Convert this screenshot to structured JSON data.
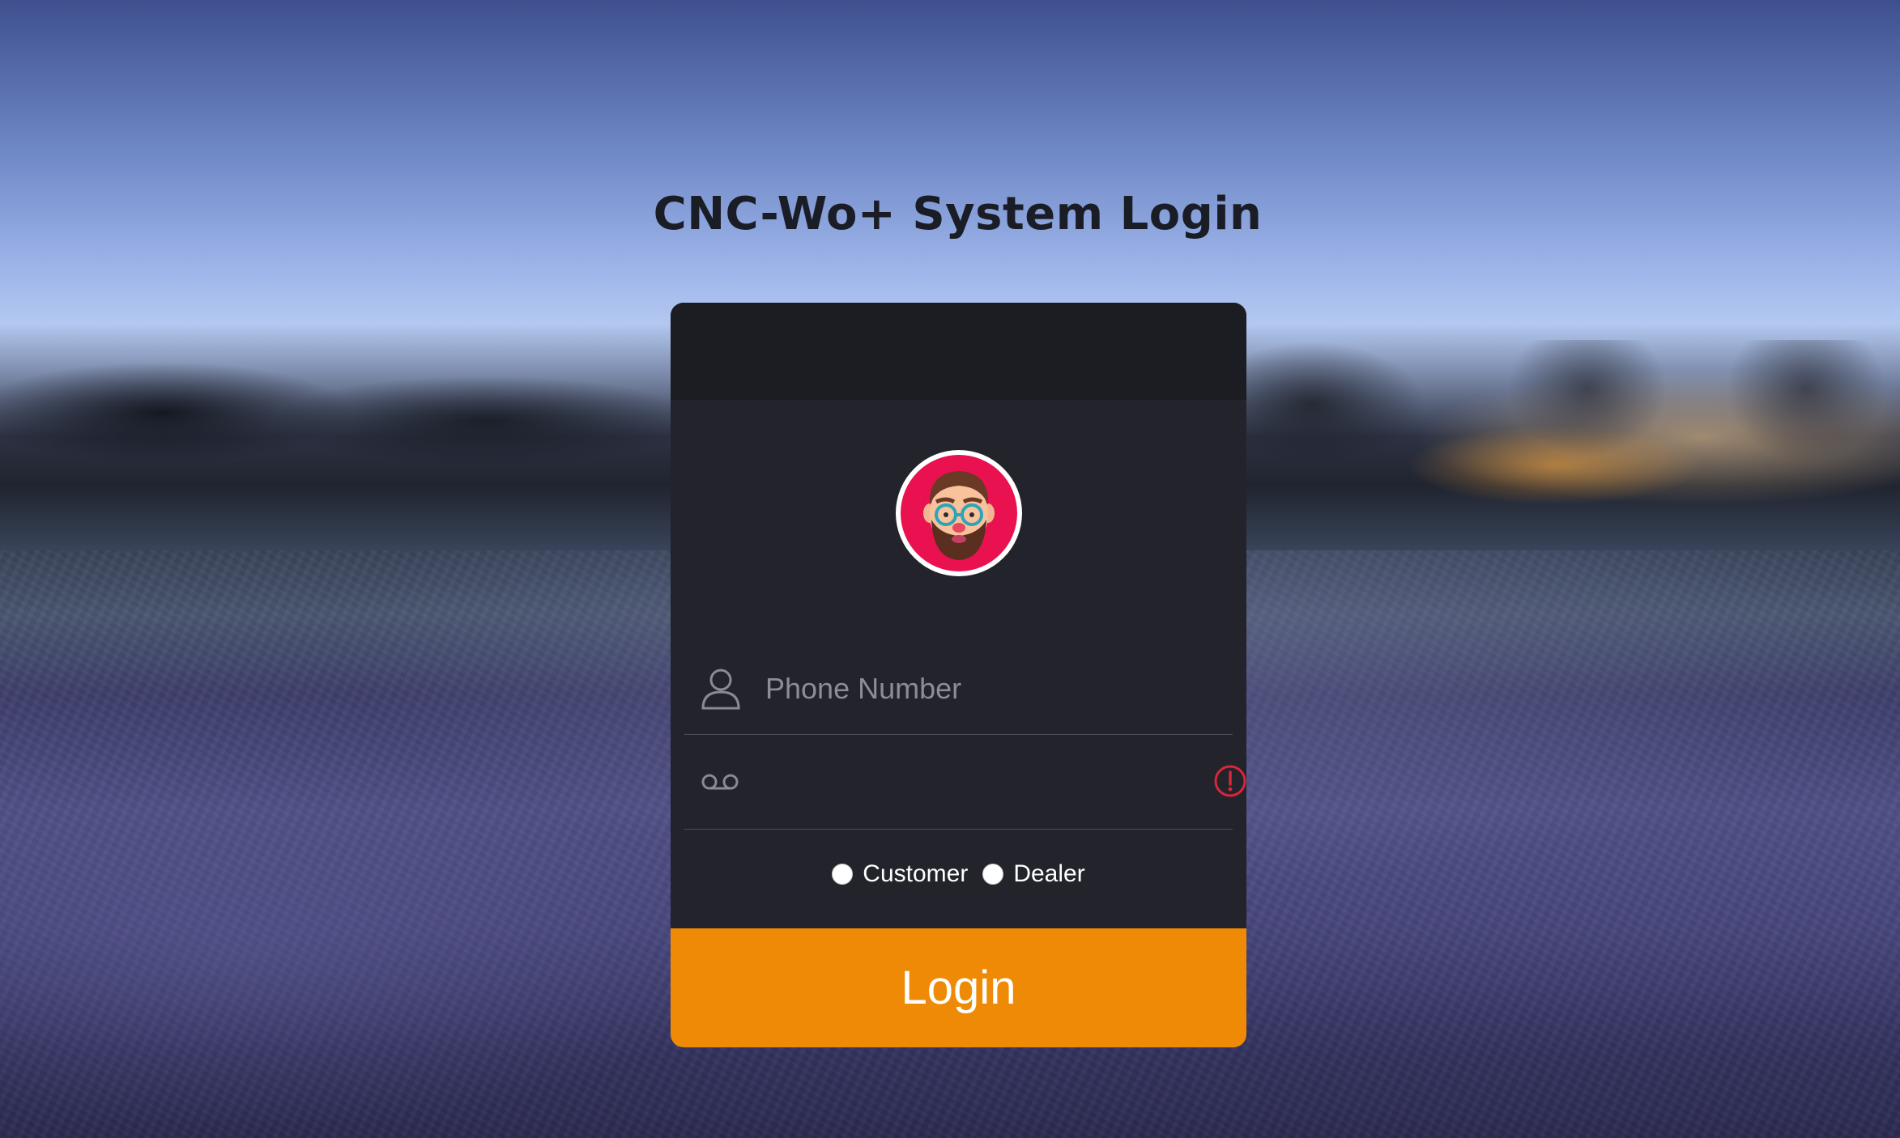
{
  "page": {
    "title": "CNC-Wo+ System Login"
  },
  "login_card": {
    "avatar_icon": "bearded-man-with-glasses-avatar",
    "phone_field": {
      "icon": "user-icon",
      "placeholder": "Phone Number",
      "value": ""
    },
    "password_field": {
      "icon": "password-key-icon",
      "value": "",
      "validation_icon": "error-alert-icon",
      "validation_color": "#d9263a"
    },
    "user_type": {
      "options": [
        {
          "label": "Customer",
          "selected": false
        },
        {
          "label": "Dealer",
          "selected": false
        }
      ]
    },
    "login_button": {
      "label": "Login",
      "color": "#ef8a06"
    }
  }
}
